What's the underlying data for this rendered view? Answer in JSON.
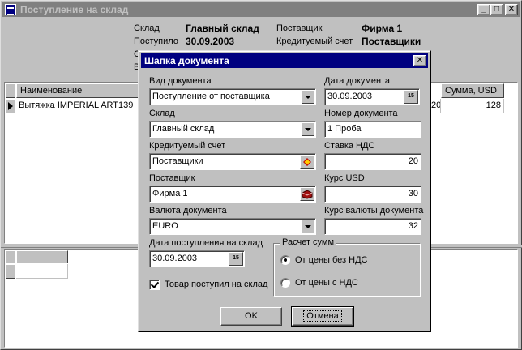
{
  "window": {
    "title": "Поступление на склад"
  },
  "header": {
    "warehouse_label": "Склад",
    "warehouse_value": "Главный склад",
    "received_label": "Поступило",
    "received_value": "30.09.2003",
    "supplier_label": "Поставщик",
    "supplier_value": "Фирма 1",
    "credit_label": "Кредитуемый счет",
    "credit_value": "Поставщики",
    "hidden_label_1": "С",
    "hidden_label_2": "В"
  },
  "grid": {
    "columns": [
      "Наименование",
      "Сумма, USD"
    ],
    "rows": [
      {
        "name": "Вытяжка IMPERIAL ART139",
        "partial": "20",
        "sum": "128"
      }
    ]
  },
  "dialog": {
    "title": "Шапка документа",
    "doc_type_label": "Вид документа",
    "doc_type_value": "Поступление от поставщика",
    "doc_date_label": "Дата документа",
    "doc_date_value": "30.09.2003",
    "warehouse_label": "Склад",
    "warehouse_value": "Главный склад",
    "doc_number_label": "Номер документа",
    "doc_number_value": "1 Проба",
    "credit_label": "Кредитуемый счет",
    "credit_value": "Поставщики",
    "vat_label": "Ставка НДС",
    "vat_value": "20",
    "supplier_label": "Поставщик",
    "supplier_value": "Фирма 1",
    "usd_rate_label": "Курс USD",
    "usd_rate_value": "30",
    "currency_label": "Валюта документа",
    "currency_value": "EURO",
    "currency_rate_label": "Курс валюты документа",
    "currency_rate_value": "32",
    "receipt_date_label": "Дата поступления на склад",
    "receipt_date_value": "30.09.2003",
    "received_checkbox_label": "Товар поступил на склад",
    "calc_group_label": "Расчет сумм",
    "radio_no_vat": "От цены без НДС",
    "radio_with_vat": "От цены с НДС",
    "ok_label": "OK",
    "cancel_label": "Отмена",
    "calendar_icon_text": "15"
  }
}
